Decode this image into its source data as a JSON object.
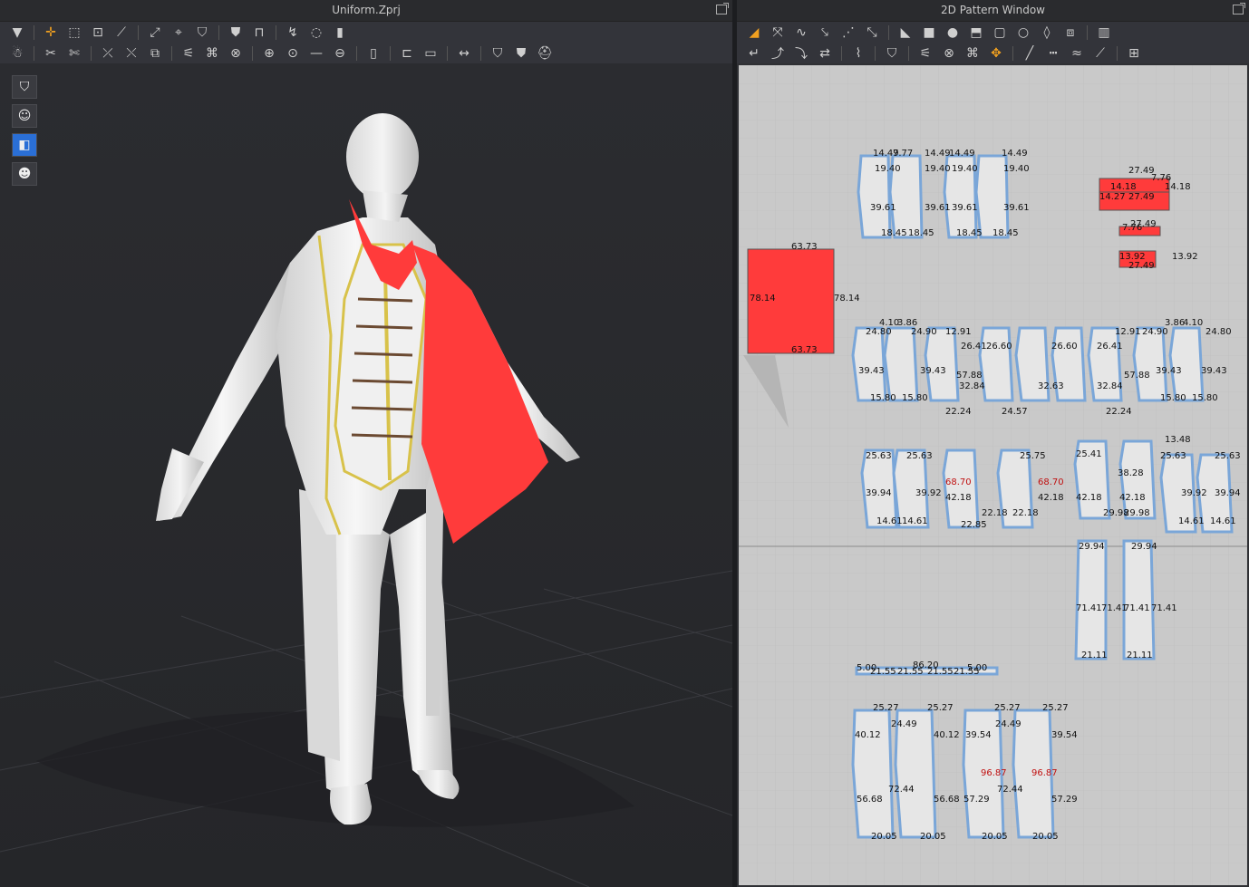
{
  "window3d": {
    "title": "Uniform.Zprj"
  },
  "window2d": {
    "title": "2D Pattern Window"
  },
  "colors": {
    "accent_red": "#ff3b3b",
    "pattern_outline": "#7aa6d8",
    "canvas_bg": "#c9c9c9",
    "selection_blue": "#2a6fd6"
  },
  "patterns": {
    "top_row": [
      "14.49",
      "7.77",
      "14.49",
      "19.40",
      "19.40",
      "39.61",
      "39.61",
      "18.45",
      "18.45",
      "14.49",
      "14.49",
      "19.40",
      "19.40",
      "39.61",
      "39.61",
      "18.45",
      "18.45"
    ],
    "red_small": [
      "27.49",
      "7.76",
      "14.18",
      "14.27",
      "27.49",
      "14.18",
      "7.76",
      "27.49",
      "13.92",
      "13.92",
      "27.49"
    ],
    "red_rect": {
      "top": "63.73",
      "bottom": "63.73",
      "left": "78.14",
      "right": "78.14"
    },
    "middle_row": [
      "4.10",
      "3.86",
      "24.80",
      "24.90",
      "12.91",
      "26.41",
      "26.60",
      "26.60",
      "26.41",
      "12.91",
      "24.90",
      "24.80",
      "39.43",
      "39.43",
      "57.88",
      "57.88",
      "39.43",
      "39.43",
      "32.84",
      "32.63",
      "32.84",
      "15.80",
      "15.80",
      "22.24",
      "24.57",
      "22.24",
      "15.80",
      "15.80",
      "3.86",
      "4.10"
    ],
    "lower_row": [
      "25.63",
      "25.63",
      "25.75",
      "25.41",
      "25.63",
      "25.63",
      "39.94",
      "39.92",
      "42.18",
      "42.18",
      "42.18",
      "38.28",
      "42.18",
      "39.92",
      "39.94",
      "14.61",
      "14.61",
      "22.18",
      "22.18",
      "22.85",
      "29.98",
      "29.98",
      "14.61",
      "14.61",
      "68.70",
      "68.70",
      "13.48"
    ],
    "sleeve": [
      "29.94",
      "29.94",
      "71.41",
      "71.41",
      "71.41",
      "71.41",
      "21.11",
      "21.11"
    ],
    "waistband": [
      "5.00",
      "21.55",
      "21.55",
      "86.20",
      "21.55",
      "21.55",
      "5.00"
    ],
    "pants": [
      "25.27",
      "25.27",
      "25.27",
      "25.27",
      "40.12",
      "24.49",
      "40.12",
      "39.54",
      "24.49",
      "39.54",
      "96.87",
      "96.87",
      "56.68",
      "72.44",
      "56.68",
      "57.29",
      "72.44",
      "57.29",
      "20.05",
      "20.05",
      "20.05",
      "20.05"
    ]
  },
  "icons3d_row1": [
    "arrow-down-icon",
    "transform-icon",
    "select-box-icon",
    "edit-pattern-icon",
    "fold-icon",
    "seam-icon",
    "pin-icon",
    "garment-icon",
    "tuck-icon",
    "sew-icon",
    "drape-icon",
    "ruler-icon"
  ],
  "icons2d_row1": [
    "transform-pattern-icon",
    "edit-point-icon",
    "curve-icon",
    "add-point-icon",
    "polygon-icon",
    "rectangle-icon",
    "circle-icon",
    "internal-polygon-icon",
    "internal-rect-icon",
    "internal-circle-icon",
    "dart-icon",
    "notch-icon"
  ]
}
